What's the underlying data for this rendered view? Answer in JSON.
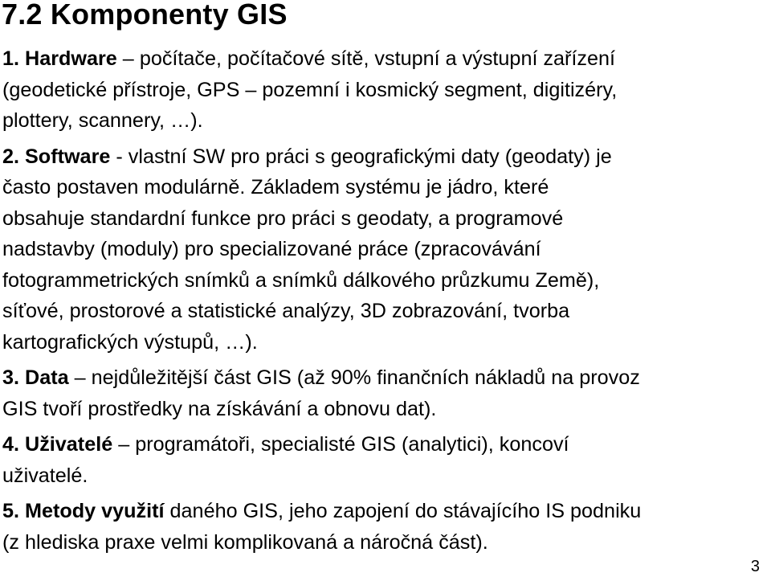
{
  "slide": {
    "title": "7.2 Komponenty GIS",
    "page_number": "3",
    "items": [
      {
        "label": "1. Hardware",
        "lines": [
          " – počítače, počítačové sítě, vstupní a výstupní zařízení",
          "(geodetické přístroje, GPS – pozemní i kosmický segment, digitizéry,",
          "plottery, scannery, …)."
        ]
      },
      {
        "label": "2. Software",
        "lines": [
          " - vlastní SW pro práci s geografickými daty (geodaty) je",
          "často postaven modulárně. Základem systému je jádro, které",
          "obsahuje standardní funkce pro práci s geodaty, a programové",
          "nadstavby (moduly) pro specializované práce (zpracovávání",
          "fotogrammetrických snímků a snímků dálkového průzkumu Země),",
          "síťové, prostorové a statistické analýzy, 3D zobrazování, tvorba",
          "kartografických výstupů, …)."
        ]
      },
      {
        "label": "3. Data",
        "lines": [
          " – nejdůležitější část GIS (až 90% finančních nákladů na provoz",
          "GIS tvoří prostředky na získávání a obnovu dat)."
        ]
      },
      {
        "label": "4. Uživatelé",
        "lines": [
          " – programátoři, specialisté GIS (analytici), koncoví",
          "uživatelé."
        ]
      },
      {
        "label": "5. Metody využití",
        "lines": [
          " daného GIS, jeho zapojení do stávajícího IS podniku",
          "(z hlediska praxe velmi komplikovaná a náročná část)."
        ]
      }
    ]
  }
}
